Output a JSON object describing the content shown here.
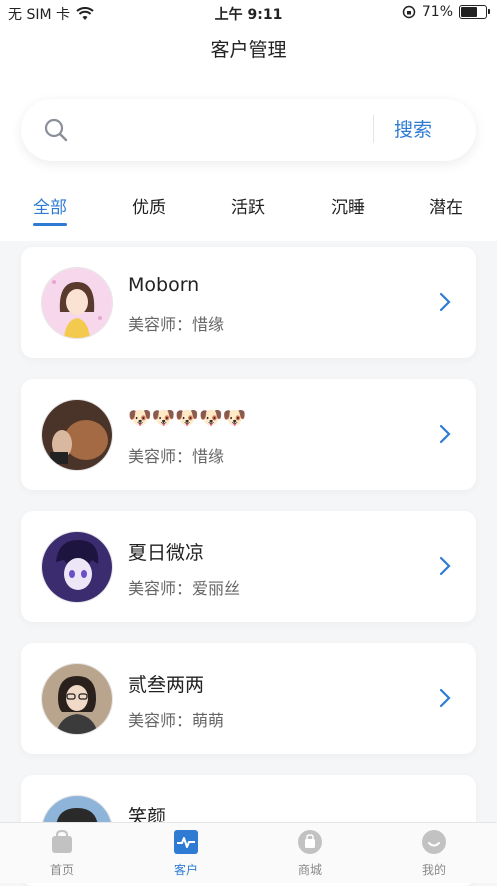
{
  "status_bar": {
    "carrier": "无 SIM 卡",
    "time": "上午 9:11",
    "battery": "71%",
    "battery_level": 0.71
  },
  "header": {
    "title": "客户管理"
  },
  "search": {
    "placeholder": "",
    "button_label": "搜索"
  },
  "tabs": [
    {
      "label": "全部",
      "active": true
    },
    {
      "label": "优质"
    },
    {
      "label": "活跃"
    },
    {
      "label": "沉睡"
    },
    {
      "label": "潜在"
    }
  ],
  "customers": [
    {
      "name": "Moborn",
      "beautician": "美容师：惜缘"
    },
    {
      "name": "🐶🐶🐶🐶🐶",
      "beautician": "美容师：惜缘"
    },
    {
      "name": "夏日微凉",
      "beautician": "美容师：爱丽丝"
    },
    {
      "name": "贰叁两两",
      "beautician": "美容师：萌萌"
    },
    {
      "name": "笑颜",
      "beautician": ""
    }
  ],
  "bottom_nav": [
    {
      "label": "首页",
      "icon": "shopping-bag-icon"
    },
    {
      "label": "客户",
      "icon": "pulse-icon",
      "active": true
    },
    {
      "label": "商城",
      "icon": "mall-icon"
    },
    {
      "label": "我的",
      "icon": "profile-icon"
    }
  ],
  "colors": {
    "accent": "#2f7bd4",
    "background": "#f5f6f8"
  }
}
